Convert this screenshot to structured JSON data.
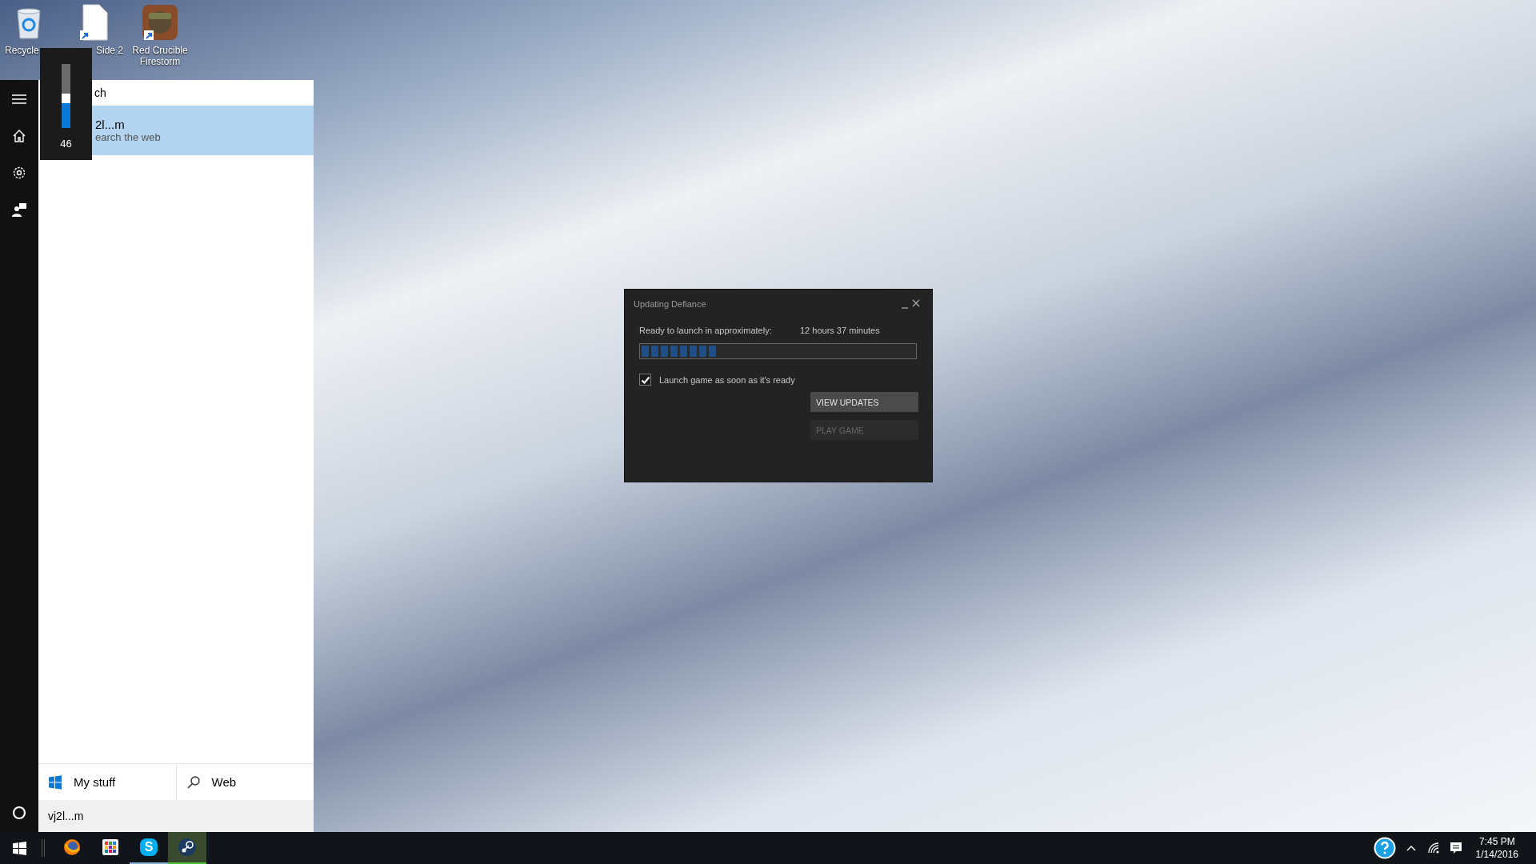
{
  "desktop_icons": [
    {
      "label": "Recycle",
      "kind": "recycle"
    },
    {
      "label": "Side 2",
      "kind": "document"
    },
    {
      "label": "Red Crucible Firestorm",
      "kind": "game"
    }
  ],
  "volume_flyout": {
    "level": 0.46,
    "reading": "46"
  },
  "search_panel": {
    "heading": "ch",
    "results": [
      {
        "title": "2l...m",
        "subtitle": "earch the web",
        "selected": true
      }
    ],
    "scopes": [
      {
        "label": "My stuff",
        "kind": "local"
      },
      {
        "label": "Web",
        "kind": "web"
      }
    ],
    "query": "vj2l...m"
  },
  "dialog": {
    "title": "Updating Defiance",
    "eta_label": "Ready to launch in approximately:",
    "eta_value": "12 hours 37 minutes",
    "progress": {
      "level": 0.28
    },
    "launch_when_ready": {
      "label": "Launch game as soon as it's ready",
      "checked": true
    },
    "buttons": [
      {
        "label": "VIEW UPDATES",
        "disabled": false
      },
      {
        "label": "PLAY GAME",
        "disabled": true
      }
    ]
  },
  "taskbar": {
    "apps": [
      {
        "kind": "firefox",
        "running": false,
        "selected": false
      },
      {
        "kind": "store",
        "running": false,
        "selected": false
      },
      {
        "kind": "skype",
        "glyph": "S",
        "running": true,
        "selected": false
      },
      {
        "kind": "steam",
        "running": true,
        "selected": true
      }
    ],
    "clock": {
      "time": "7:45 PM",
      "date": "1/14/2016"
    }
  }
}
